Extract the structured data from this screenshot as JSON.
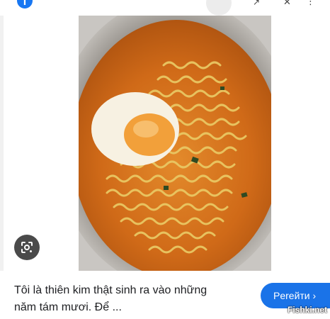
{
  "top_bar": {
    "brand_icon": "facebook-icon",
    "brand_letter": "f",
    "actions": [
      "share-icon",
      "close-icon",
      "more-icon"
    ]
  },
  "image": {
    "lens_icon": "google-lens-icon"
  },
  "caption": {
    "line1": "Tôi là thiên kim thật sinh ra vào những",
    "line2": "năm tám mươi. Để ..."
  },
  "visit_button": {
    "label": "Perейти ›"
  },
  "watermark": {
    "text": "Fishki.net"
  },
  "colors": {
    "accent": "#1a73e8",
    "brand": "#1877f2",
    "broth": "#d9751f",
    "noodle": "#e8c45a"
  }
}
